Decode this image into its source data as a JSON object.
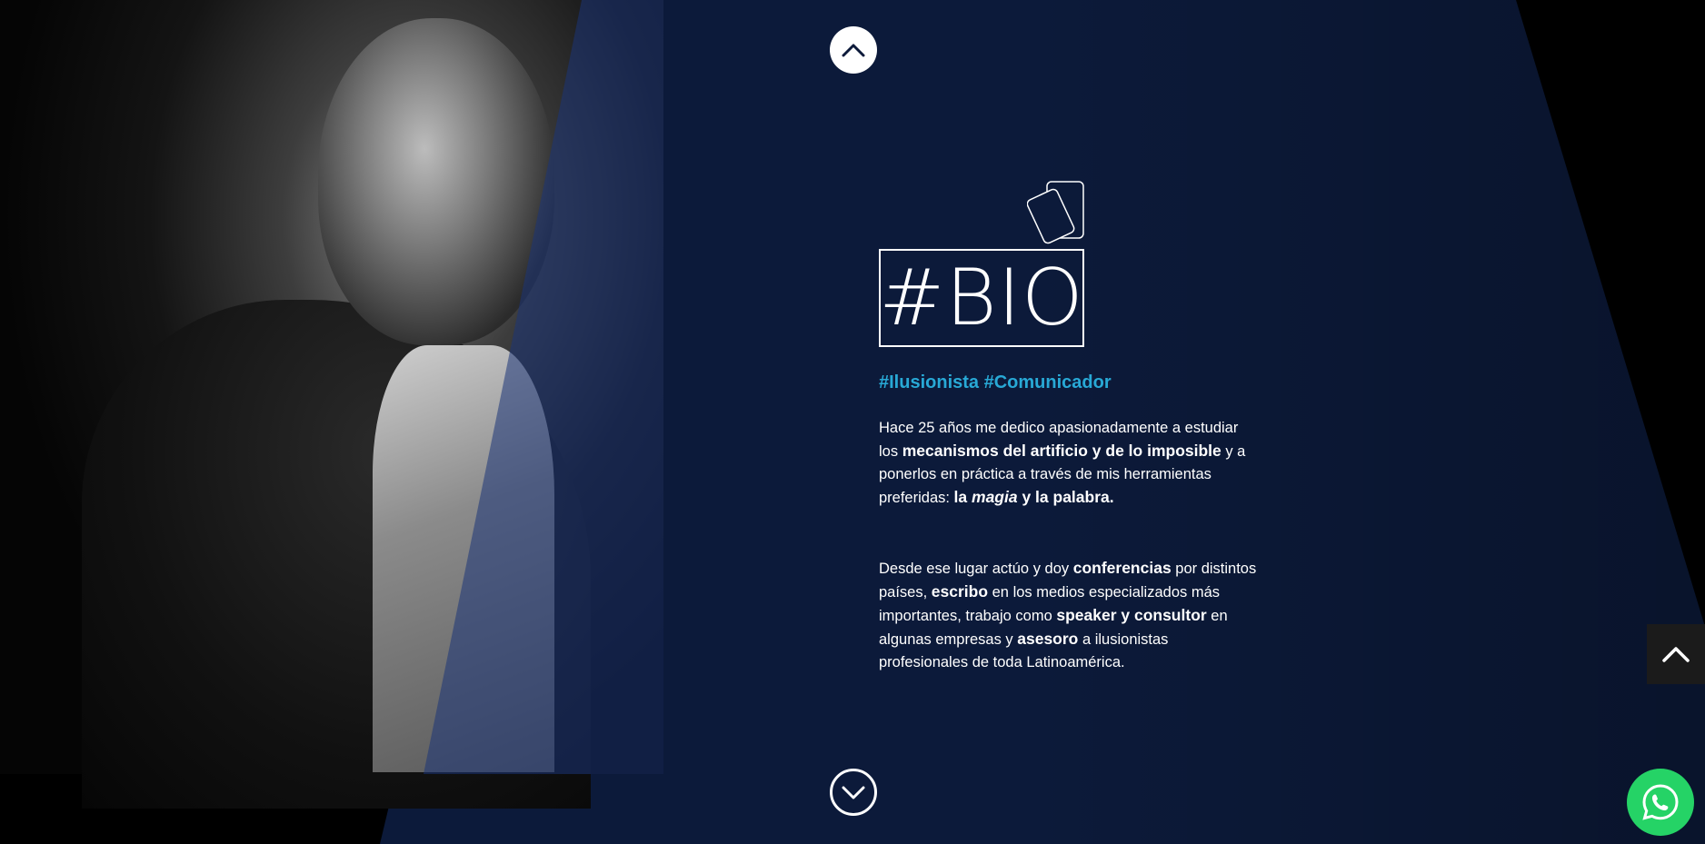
{
  "bio": {
    "title": "#BIO",
    "tagline": "#Ilusionista #Comunicador",
    "para1": [
      {
        "t": "Hace 25 años me dedico apasionadamente a estudiar los ",
        "s": "n"
      },
      {
        "t": "mecanismos del artificio y de lo imposible",
        "s": "b"
      },
      {
        "t": " y a ponerlos en práctica a través de mis herramientas preferidas: ",
        "s": "n"
      },
      {
        "t": "la ",
        "s": "b"
      },
      {
        "t": "magia",
        "s": "bi"
      },
      {
        "t": " y la palabra.",
        "s": "b"
      }
    ],
    "para2": [
      {
        "t": "Desde ese lugar actúo y doy ",
        "s": "n"
      },
      {
        "t": "conferencias",
        "s": "b"
      },
      {
        "t": " por distintos países, ",
        "s": "n"
      },
      {
        "t": "escribo",
        "s": "b"
      },
      {
        "t": " en los medios especializados más importantes, trabajo como ",
        "s": "n"
      },
      {
        "t": "speaker y consultor",
        "s": "b"
      },
      {
        "t": " en algunas empresas y ",
        "s": "n"
      },
      {
        "t": "asesoro",
        "s": "b"
      },
      {
        "t": " a ilusionistas profesionales de toda Latinoamérica.",
        "s": "n"
      }
    ]
  },
  "nav": {
    "up_icon": "chevron-up-icon",
    "down_icon": "chevron-down-icon",
    "scroll_top_icon": "chevron-up-icon",
    "whatsapp_icon": "whatsapp-icon",
    "cards_icon": "playing-cards-icon"
  },
  "colors": {
    "beam": "#0c1a3a",
    "accent": "#28a9d6",
    "whatsapp": "#25d366"
  }
}
